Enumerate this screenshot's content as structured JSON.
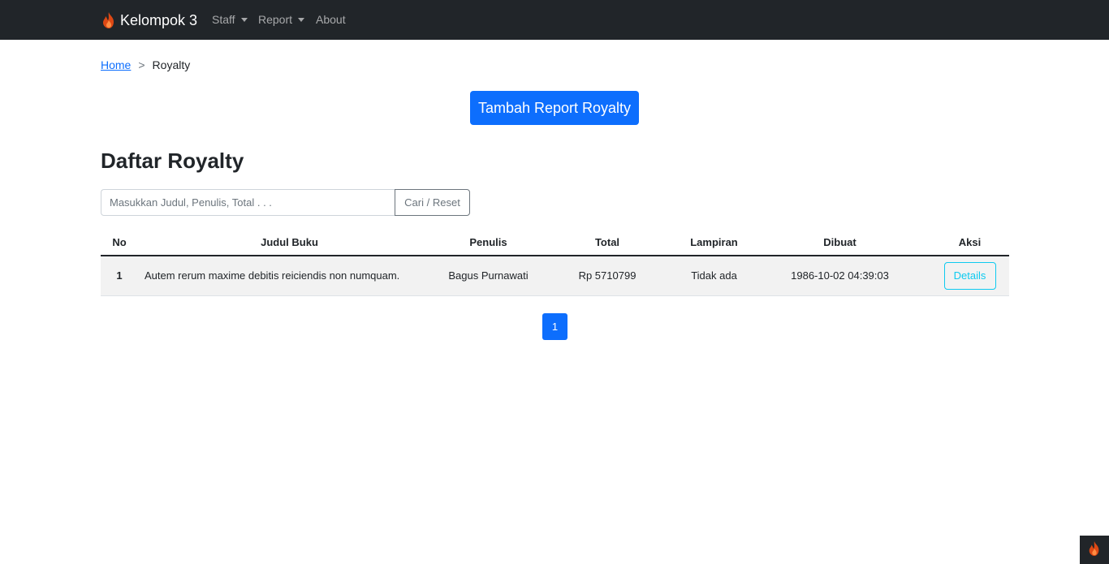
{
  "navbar": {
    "brand": "Kelompok 3",
    "brand_icon": "flame-icon",
    "items": [
      {
        "label": "Staff",
        "dropdown": true
      },
      {
        "label": "Report",
        "dropdown": true
      },
      {
        "label": "About",
        "dropdown": false
      }
    ]
  },
  "breadcrumb": {
    "home": "Home",
    "separator": ">",
    "current": "Royalty"
  },
  "add_button": "Tambah Report Royalty",
  "page_title": "Daftar Royalty",
  "search": {
    "placeholder": "Masukkan Judul, Penulis, Total . . .",
    "value": "",
    "button": "Cari / Reset"
  },
  "table": {
    "headers": [
      "No",
      "Judul Buku",
      "Penulis",
      "Total",
      "Lampiran",
      "Dibuat",
      "Aksi"
    ],
    "rows": [
      {
        "no": "1",
        "judul": "Autem rerum maxime debitis reiciendis non numquam.",
        "penulis": "Bagus Purnawati",
        "total": "Rp 5710799",
        "lampiran": "Tidak ada",
        "dibuat": "1986-10-02 04:39:03",
        "aksi": "Details"
      }
    ]
  },
  "pagination": {
    "current_page": "1"
  },
  "colors": {
    "navbar_bg": "#212529",
    "primary": "#0d6efd",
    "info": "#0dcaf0",
    "brand_flame": "#dd4814"
  }
}
